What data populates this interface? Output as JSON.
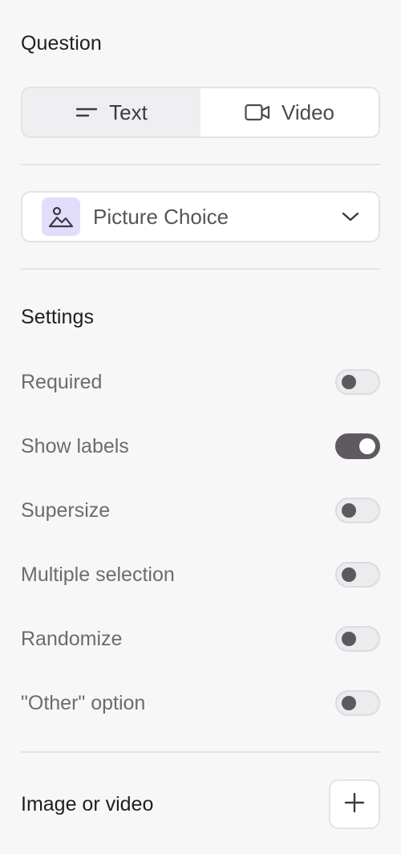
{
  "question": {
    "title": "Question",
    "tabs": [
      {
        "label": "Text",
        "icon": "text-lines-icon",
        "active": true
      },
      {
        "label": "Video",
        "icon": "video-camera-icon",
        "active": false
      }
    ],
    "type_select": {
      "icon": "picture-icon",
      "value": "Picture Choice",
      "accent": "#e3dcfb"
    }
  },
  "settings": {
    "title": "Settings",
    "items": [
      {
        "label": "Required",
        "on": false
      },
      {
        "label": "Show labels",
        "on": true
      },
      {
        "label": "Supersize",
        "on": false
      },
      {
        "label": "Multiple selection",
        "on": false
      },
      {
        "label": "Randomize",
        "on": false
      },
      {
        "label": "\"Other\" option",
        "on": false
      }
    ]
  },
  "media": {
    "title": "Image or video",
    "add_icon": "plus-icon"
  },
  "colors": {
    "toggle_on": "#5f5960",
    "background": "#f7f7f7"
  }
}
